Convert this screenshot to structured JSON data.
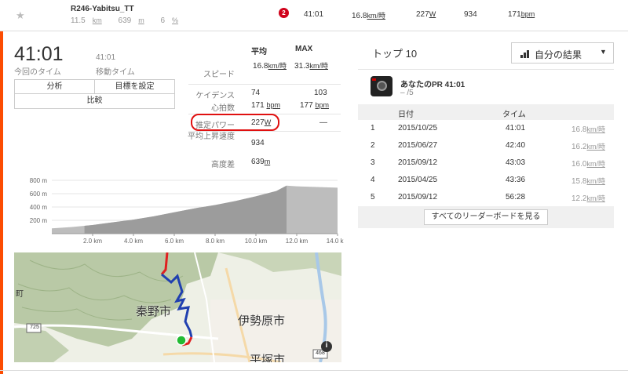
{
  "header": {
    "segment_name": "R246-Yabitsu_TT",
    "distance": "11.5",
    "distance_unit": "km",
    "elevation": "639",
    "elevation_unit": "m",
    "grade": "6",
    "grade_unit": "%",
    "badge": "2",
    "time": "41:01",
    "speed": "16.8",
    "speed_unit": "km/時",
    "power": "227",
    "power_unit": "W",
    "heartrate_or_other": "934",
    "hr": "171",
    "hr_unit": "bpm"
  },
  "summary": {
    "elapsed_time": "41:01",
    "elapsed_label": "今回のタイム",
    "moving_time": "41:01",
    "moving_label": "移動タイム",
    "btn_analyze": "分析",
    "btn_goal": "目標を設定",
    "btn_compare": "比較"
  },
  "stats": {
    "col_avg": "平均",
    "col_max": "MAX",
    "rows": [
      {
        "label": "スピード",
        "avg": "16.8",
        "avg_unit": "km/時",
        "max": "31.3",
        "max_unit": "km/時"
      },
      {
        "label": "ケイデンス",
        "avg": "74",
        "max": "103"
      },
      {
        "label": "心拍数",
        "avg": "171",
        "avg_unit": "bpm",
        "max": "177",
        "max_unit": "bpm"
      },
      {
        "label": "推定パワー",
        "avg": "227",
        "avg_unit": "W",
        "max": "—"
      },
      {
        "label": "平均上昇速度",
        "avg": "934"
      },
      {
        "label": "高度差",
        "avg": "639",
        "avg_unit": "m"
      }
    ]
  },
  "chart_data": {
    "type": "area",
    "title": "",
    "xlabel": "",
    "ylabel": "",
    "x_ticks": [
      "2.0 km",
      "4.0 km",
      "6.0 km",
      "8.0 km",
      "10.0 km",
      "12.0 km",
      "14.0 km"
    ],
    "y_ticks": [
      "800 m",
      "600 m",
      "400 m",
      "200 m"
    ],
    "xlim": [
      0,
      14
    ],
    "ylim": [
      0,
      800
    ],
    "x": [
      0,
      0.5,
      1,
      2,
      3,
      4,
      5,
      6,
      7,
      8,
      9,
      10,
      11,
      11.5,
      12,
      13,
      14
    ],
    "values": [
      80,
      90,
      100,
      130,
      170,
      210,
      260,
      320,
      380,
      430,
      490,
      560,
      640,
      720,
      710,
      700,
      690
    ],
    "highlight_start_km": 1.6,
    "highlight_end_km": 11.5,
    "colors": {
      "fill": "#9c9c9c",
      "highlight": "#bdbdbd",
      "grid": "#e5e5e5"
    }
  },
  "map": {
    "labels": [
      "秦野市",
      "伊勢原市",
      "平塚市"
    ],
    "shields": [
      "725",
      "468"
    ],
    "edge_text": "町",
    "info_icon": "i"
  },
  "leaderboard": {
    "title": "トップ 10",
    "dropdown_label": "自分の結果",
    "pr_title": "あなたのPR 41:01",
    "pr_sub": "– /5",
    "col_date": "日付",
    "col_time": "タイム",
    "rows": [
      {
        "rank": "1",
        "date": "2015/10/25",
        "time": "41:01",
        "speed": "16.8",
        "unit": "km/時"
      },
      {
        "rank": "2",
        "date": "2015/06/27",
        "time": "42:40",
        "speed": "16.2",
        "unit": "km/時"
      },
      {
        "rank": "3",
        "date": "2015/09/12",
        "time": "43:03",
        "speed": "16.0",
        "unit": "km/時"
      },
      {
        "rank": "4",
        "date": "2015/04/25",
        "time": "43:36",
        "speed": "15.8",
        "unit": "km/時"
      },
      {
        "rank": "5",
        "date": "2015/09/12",
        "time": "56:28",
        "speed": "12.2",
        "unit": "km/時"
      }
    ],
    "view_all": "すべてのリーダーボードを見る"
  }
}
